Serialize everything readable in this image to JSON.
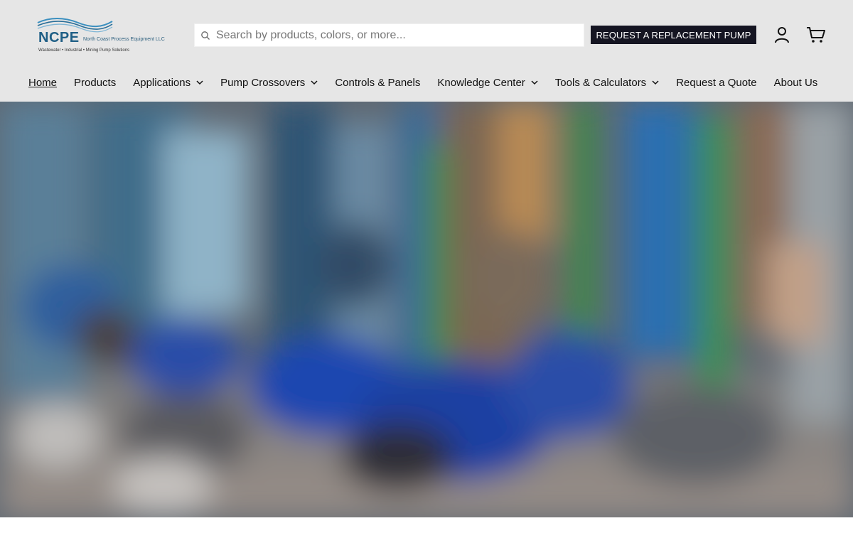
{
  "logo": {
    "brand": "NCPE",
    "company": "North Coast Process Equipment LLC",
    "tagline": "Wastewater • Industrial • Mining Pump Solutions"
  },
  "search": {
    "placeholder": "Search by products, colors, or more...",
    "icon": "search-icon"
  },
  "cta": {
    "label": "REQUEST A REPLACEMENT PUMP"
  },
  "header_icons": {
    "account": "user-icon",
    "cart": "cart-icon"
  },
  "nav": {
    "items": [
      {
        "label": "Home",
        "active": true
      },
      {
        "label": "Products"
      },
      {
        "label": "Applications",
        "dropdown": true
      },
      {
        "label": "Pump Crossovers",
        "dropdown": true
      },
      {
        "label": "Controls & Panels"
      },
      {
        "label": "Knowledge Center",
        "dropdown": true
      },
      {
        "label": "Tools & Calculators",
        "dropdown": true
      },
      {
        "label": "Request a Quote"
      },
      {
        "label": "About Us"
      }
    ]
  },
  "hero": {
    "image": "blurred photo of industrial pump room with blue pumps and green pipes"
  },
  "colors": {
    "cta_bg": "#151522",
    "header_bg": "#e6e6e6",
    "brand_blue": "#1f5f86"
  }
}
